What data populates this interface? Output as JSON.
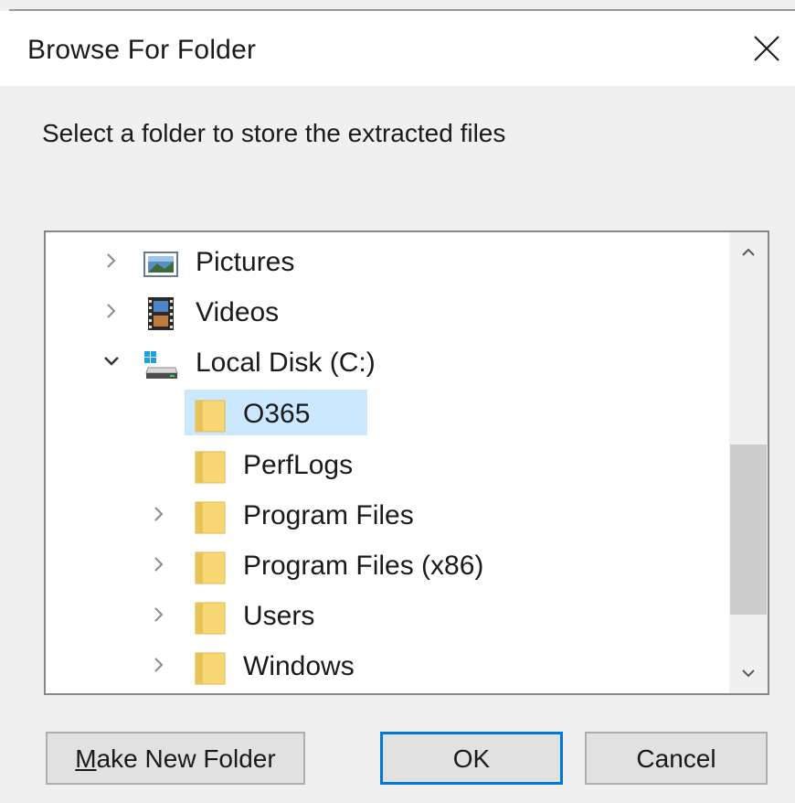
{
  "window": {
    "title": "Browse For Folder"
  },
  "prompt": "Select a folder to store the extracted files",
  "tree": {
    "items": [
      {
        "label": "Pictures",
        "icon": "pictures-icon",
        "expander": "collapsed"
      },
      {
        "label": "Videos",
        "icon": "videos-icon",
        "expander": "collapsed"
      },
      {
        "label": "Local Disk (C:)",
        "icon": "local-disk-icon",
        "expander": "expanded"
      },
      {
        "label": "O365",
        "icon": "folder-icon",
        "expander": "none",
        "selected": true
      },
      {
        "label": "PerfLogs",
        "icon": "folder-icon",
        "expander": "none"
      },
      {
        "label": "Program Files",
        "icon": "folder-icon",
        "expander": "collapsed"
      },
      {
        "label": "Program Files (x86)",
        "icon": "folder-icon",
        "expander": "collapsed"
      },
      {
        "label": "Users",
        "icon": "folder-icon",
        "expander": "collapsed"
      },
      {
        "label": "Windows",
        "icon": "folder-icon",
        "expander": "collapsed"
      }
    ]
  },
  "buttons": {
    "make_new_folder_first": "M",
    "make_new_folder_rest": "ake New Folder",
    "ok": "OK",
    "cancel": "Cancel"
  },
  "colors": {
    "accent": "#0078d7",
    "selection": "#cce8ff",
    "folder": "#f8d775"
  }
}
